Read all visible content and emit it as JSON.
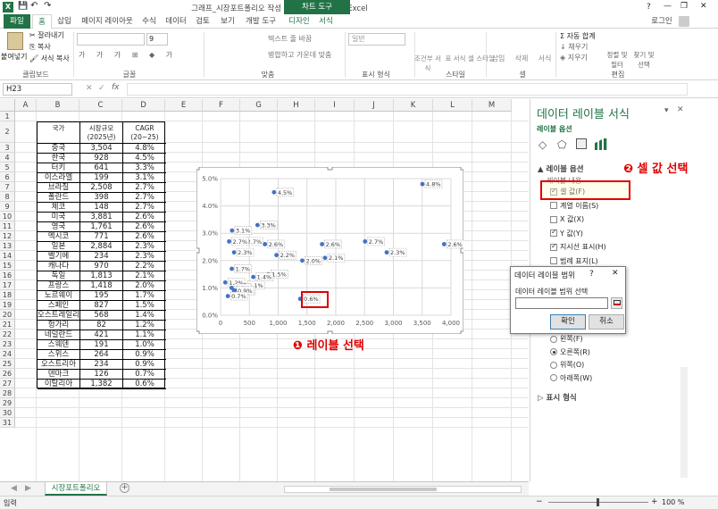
{
  "titlebar": {
    "title": "그래프_시장포트폴리오 작성 0109 - Microsoft Excel",
    "context_tab": "차트 도구",
    "help": "?",
    "minimize": "—",
    "restore": "❐",
    "close": "✕"
  },
  "tabs": {
    "file": "파일",
    "home": "홈",
    "insert": "삽입",
    "layout": "페이지 레이아웃",
    "formulas": "수식",
    "data": "데이터",
    "review": "검토",
    "view": "보기",
    "developer": "개발 도구",
    "design": "디자인",
    "format": "서식",
    "login": "로그인"
  },
  "ribbon": {
    "paste": "붙여넣기",
    "cut": "잘라내기",
    "copy": "복사",
    "format_painter": "서식 복사",
    "clipboard": "클립보드",
    "font_size": "9",
    "font": "글꼴",
    "wrap": "텍스트 줄 바꿈",
    "merge": "병합하고 가운데 맞춤",
    "align": "맞춤",
    "numfmt": "일반",
    "number": "표시 형식",
    "cond": "조건부 서식",
    "table": "표 서식",
    "cellstyle": "셀 스타일",
    "style": "스타일",
    "insert": "삽입",
    "delete": "삭제",
    "format": "서식",
    "cells": "셀",
    "autosum": "자동 합계",
    "fill": "채우기",
    "clear": "지우기",
    "sort": "정렬 및 필터",
    "find": "찾기 및 선택",
    "edit": "편집"
  },
  "formula": {
    "namebox": "H23",
    "fx": "fx",
    "value": ""
  },
  "columns": [
    "A",
    "B",
    "C",
    "D",
    "E",
    "F",
    "G",
    "H",
    "I",
    "J",
    "K",
    "L",
    "M"
  ],
  "rows": [
    "1",
    "2",
    "3",
    "4",
    "5",
    "6",
    "7",
    "8",
    "9",
    "10",
    "11",
    "12",
    "13",
    "14",
    "15",
    "16",
    "17",
    "18",
    "19",
    "20",
    "21",
    "22",
    "23",
    "24",
    "25",
    "26",
    "27",
    "28",
    "29",
    "30",
    "31"
  ],
  "table": {
    "head": {
      "country": "국가",
      "size": "시장규모\n(2025년)",
      "cagr": "CAGR\n(20~25)"
    },
    "rows": [
      [
        "중국",
        "3,504",
        "4.8%"
      ],
      [
        "한국",
        "928",
        "4.5%"
      ],
      [
        "터키",
        "641",
        "3.3%"
      ],
      [
        "이스라엘",
        "199",
        "3.1%"
      ],
      [
        "브라질",
        "2,508",
        "2.7%"
      ],
      [
        "폴란드",
        "398",
        "2.7%"
      ],
      [
        "체코",
        "148",
        "2.7%"
      ],
      [
        "미국",
        "3,881",
        "2.6%"
      ],
      [
        "영국",
        "1,761",
        "2.6%"
      ],
      [
        "멕시코",
        "771",
        "2.6%"
      ],
      [
        "일본",
        "2,884",
        "2.3%"
      ],
      [
        "벨기에",
        "234",
        "2.3%"
      ],
      [
        "캐나다",
        "970",
        "2.2%"
      ],
      [
        "독일",
        "1,813",
        "2.1%"
      ],
      [
        "프랑스",
        "1,418",
        "2.0%"
      ],
      [
        "노르웨이",
        "195",
        "1.7%"
      ],
      [
        "스페인",
        "827",
        "1.5%"
      ],
      [
        "오스트레일리아",
        "568",
        "1.4%"
      ],
      [
        "헝가리",
        "82",
        "1.2%"
      ],
      [
        "네덜란드",
        "421",
        "1.1%"
      ],
      [
        "스웨덴",
        "191",
        "1.0%"
      ],
      [
        "스위스",
        "264",
        "0.9%"
      ],
      [
        "오스트리아",
        "234",
        "0.9%"
      ],
      [
        "덴마크",
        "126",
        "0.7%"
      ],
      [
        "이탈리아",
        "1,382",
        "0.6%"
      ]
    ]
  },
  "chart_data": {
    "type": "scatter",
    "title": "",
    "xlim": [
      0,
      4000
    ],
    "ylim": [
      0,
      5
    ],
    "xticks": [
      "0",
      "500",
      "1,000",
      "1,500",
      "2,000",
      "2,500",
      "3,000",
      "3,500",
      "4,000"
    ],
    "yticks": [
      "0.0%",
      "1.0%",
      "2.0%",
      "3.0%",
      "4.0%",
      "5.0%"
    ],
    "grid": true,
    "points": [
      {
        "x": 3504,
        "y": 4.8,
        "label": "4.8%"
      },
      {
        "x": 928,
        "y": 4.5,
        "label": "4.5%"
      },
      {
        "x": 641,
        "y": 3.3,
        "label": "3.3%"
      },
      {
        "x": 199,
        "y": 3.1,
        "label": "3.1%"
      },
      {
        "x": 2508,
        "y": 2.7,
        "label": "2.7%"
      },
      {
        "x": 398,
        "y": 2.7,
        "label": "2.7%"
      },
      {
        "x": 148,
        "y": 2.7,
        "label": "2.7%"
      },
      {
        "x": 3881,
        "y": 2.6,
        "label": "2.6%"
      },
      {
        "x": 1761,
        "y": 2.6,
        "label": "2.6%"
      },
      {
        "x": 771,
        "y": 2.6,
        "label": "2.6%"
      },
      {
        "x": 2884,
        "y": 2.3,
        "label": "2.3%"
      },
      {
        "x": 234,
        "y": 2.3,
        "label": "2.3%"
      },
      {
        "x": 970,
        "y": 2.2,
        "label": "2.2%"
      },
      {
        "x": 1813,
        "y": 2.1,
        "label": "2.1%"
      },
      {
        "x": 1418,
        "y": 2.0,
        "label": "2.0%"
      },
      {
        "x": 195,
        "y": 1.7,
        "label": "1.7%"
      },
      {
        "x": 827,
        "y": 1.5,
        "label": "1.5%"
      },
      {
        "x": 568,
        "y": 1.4,
        "label": "1.4%"
      },
      {
        "x": 82,
        "y": 1.2,
        "label": "1.2%"
      },
      {
        "x": 421,
        "y": 1.1,
        "label": "1.1%"
      },
      {
        "x": 191,
        "y": 1.0,
        "label": "1.0%"
      },
      {
        "x": 264,
        "y": 0.9,
        "label": "0.9%"
      },
      {
        "x": 234,
        "y": 0.9,
        "label": "0.9%"
      },
      {
        "x": 126,
        "y": 0.7,
        "label": "0.7%"
      },
      {
        "x": 1382,
        "y": 0.6,
        "label": "0.6%"
      }
    ],
    "marker_color": "#4472c4"
  },
  "annotations": {
    "step1": "❶ 레이블 선택",
    "step2": "❷ 셀 값 선택",
    "accent": "#e00000"
  },
  "pane": {
    "title": "데이터 레이블 서식",
    "close": "✕",
    "pin": "▾",
    "options": "레이블 옵션",
    "section": "레이블 옵션",
    "contains": "레이블 내용",
    "items": [
      "셀 값(F)",
      "계열 이름(S)",
      "X 값(X)",
      "Y 값(Y)",
      "지시선 표시(H)",
      "범례 표지(L)"
    ],
    "checked": [
      true,
      false,
      false,
      true,
      true,
      false
    ],
    "positions": [
      "왼쪽(F)",
      "오른쪽(R)",
      "위쪽(O)",
      "아래쪽(W)"
    ],
    "pos_selected": 1,
    "number": "표시 형식"
  },
  "dialog": {
    "title": "데이터 레이블 범위",
    "help": "?",
    "close": "✕",
    "label": "데이터 레이블 범위 선택",
    "ok": "확인",
    "cancel": "취소",
    "value": ""
  },
  "sheet": {
    "tab": "시장포트폴리오",
    "add": "+"
  },
  "status": {
    "ready": "입력",
    "zoom": "100 %",
    "minus": "−",
    "plus": "+"
  }
}
